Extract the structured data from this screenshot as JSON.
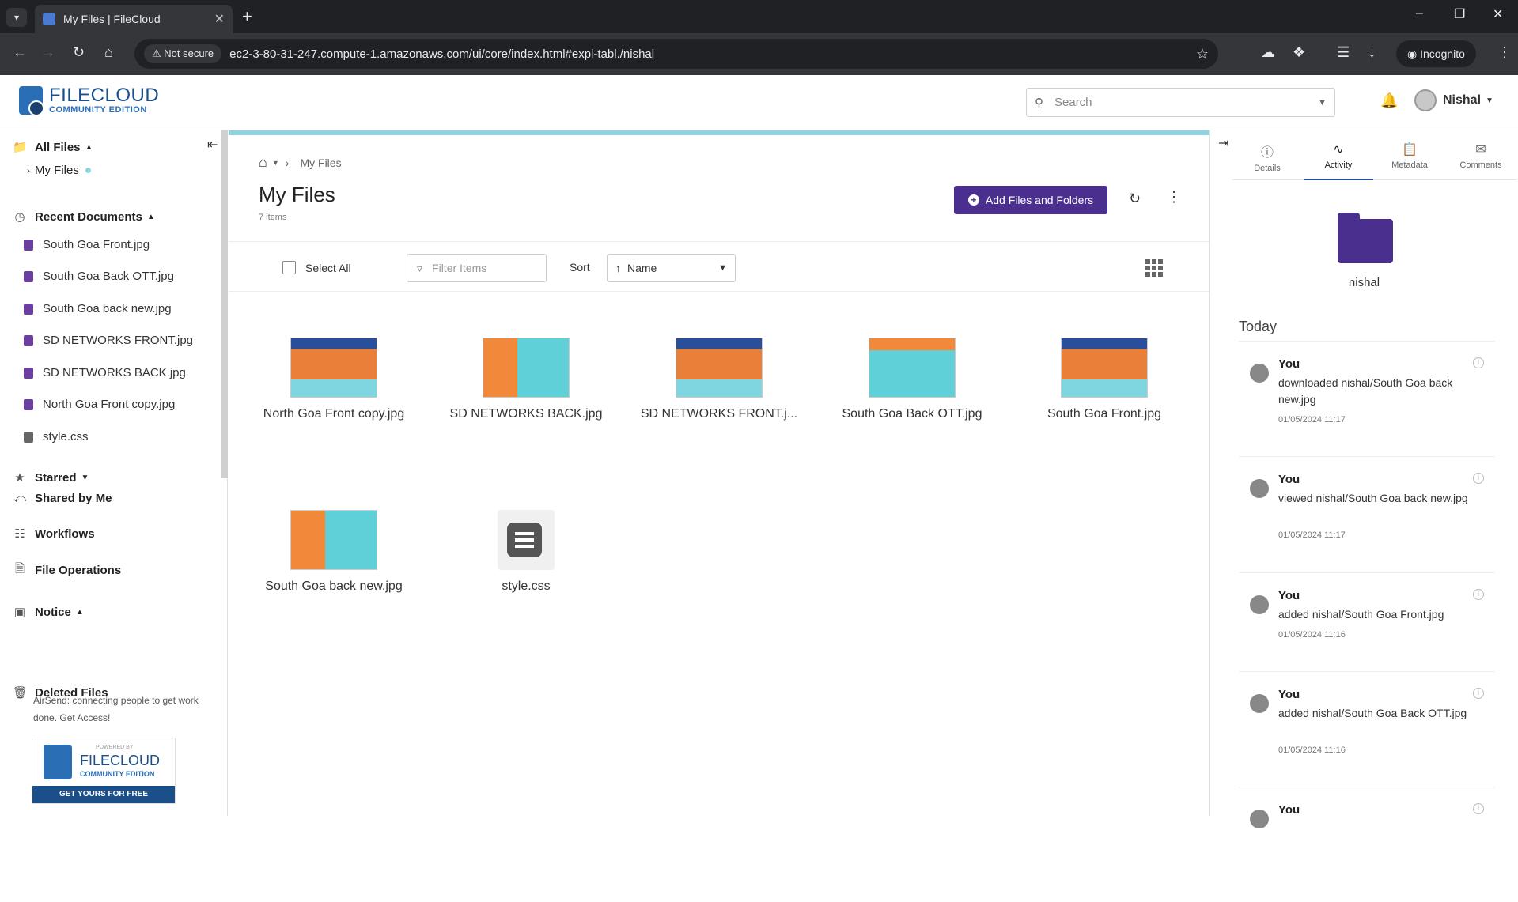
{
  "browser": {
    "tab_title": "My Files | FileCloud",
    "not_secure": "Not secure",
    "url": "ec2-3-80-31-247.compute-1.amazonaws.com/ui/core/index.html#expl-tabl./nishal",
    "incognito": "Incognito"
  },
  "header": {
    "logo_title": "FILECLOUD",
    "logo_subtitle": "COMMUNITY EDITION",
    "search_placeholder": "Search",
    "user_name": "Nishal"
  },
  "sidebar": {
    "all_files": "All Files",
    "my_files": "My Files",
    "recent_documents": "Recent Documents",
    "recent": [
      "South Goa Front.jpg",
      "South Goa Back OTT.jpg",
      "South Goa back new.jpg",
      "SD NETWORKS FRONT.jpg",
      "SD NETWORKS BACK.jpg",
      "North Goa Front copy.jpg",
      "style.css"
    ],
    "starred": "Starred",
    "shared_by_me": "Shared by Me",
    "workflows": "Workflows",
    "file_operations": "File Operations",
    "notice": "Notice",
    "notice_text": "AirSend: connecting people to get work done. Get Access!",
    "deleted_files": "Deleted Files",
    "promo": {
      "powered_by": "POWERED BY",
      "title": "FILECLOUD",
      "subtitle": "COMMUNITY EDITION",
      "cta": "GET YOURS FOR FREE"
    }
  },
  "main": {
    "breadcrumb": "My Files",
    "title": "My Files",
    "count": "7 items",
    "add_button": "Add Files and Folders",
    "select_all": "Select All",
    "filter_placeholder": "Filter Items",
    "sort_label": "Sort",
    "sort_value": "Name",
    "files": [
      {
        "name": "North Goa Front copy.jpg",
        "thumb": "blue"
      },
      {
        "name": "SD NETWORKS BACK.jpg",
        "thumb": "orange"
      },
      {
        "name": "SD NETWORKS FRONT.j...",
        "thumb": "blue"
      },
      {
        "name": "South Goa Back OTT.jpg",
        "thumb": "teal"
      },
      {
        "name": "South Goa Front.jpg",
        "thumb": "blue"
      },
      {
        "name": "South Goa back new.jpg",
        "thumb": "orange"
      },
      {
        "name": "style.css",
        "thumb": "doc"
      }
    ]
  },
  "right_panel": {
    "tabs": [
      "Details",
      "Activity",
      "Metadata",
      "Comments"
    ],
    "active_tab": "Activity",
    "folder_name": "nishal",
    "today": "Today",
    "activities": [
      {
        "who": "You",
        "text": "downloaded nishal/South Goa back new.jpg",
        "time": "01/05/2024 11:17"
      },
      {
        "who": "You",
        "text": "viewed nishal/South Goa back new.jpg",
        "time": "01/05/2024 11:17"
      },
      {
        "who": "You",
        "text": "added nishal/South Goa Front.jpg",
        "time": "01/05/2024 11:16"
      },
      {
        "who": "You",
        "text": "added nishal/South Goa Back OTT.jpg",
        "time": "01/05/2024 11:16"
      },
      {
        "who": "You",
        "text": "",
        "time": ""
      }
    ]
  },
  "colors": {
    "brand_purple": "#4a2f8f",
    "brand_blue": "#1b4f8a",
    "accent_cyan": "#8dd3e0"
  }
}
